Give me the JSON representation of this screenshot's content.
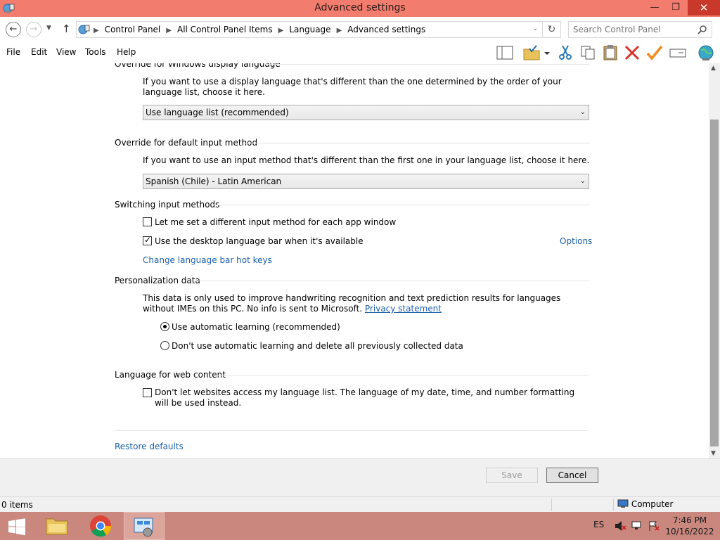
{
  "window": {
    "title": "Advanced settings",
    "minimize_glyph": "—",
    "maximize_glyph": "❐",
    "close_glyph": "✕"
  },
  "address": {
    "breadcrumbs": [
      "Control Panel",
      "All Control Panel Items",
      "Language",
      "Advanced settings"
    ],
    "search_placeholder": "Search Control Panel"
  },
  "menu": {
    "items": [
      "File",
      "Edit",
      "View",
      "Tools",
      "Help"
    ]
  },
  "toolbar": {
    "icons": [
      "layout-pane-icon",
      "folder-check-icon",
      "dropdown-icon",
      "cut-icon",
      "copy-icon",
      "paste-icon",
      "delete-icon",
      "checkmark-icon",
      "properties-icon",
      "globe-icon"
    ]
  },
  "sections": {
    "display_language": {
      "heading": "Override for Windows display language",
      "description": "If you want to use a display language that's different than the one determined by the order of your language list, choose it here.",
      "selected": "Use language list (recommended)"
    },
    "input_method": {
      "heading": "Override for default input method",
      "description": "If you want to use an input method that's different than the first one in your language list, choose it here.",
      "selected": "Spanish (Chile) - Latin American"
    },
    "switching": {
      "heading": "Switching input methods",
      "option1": "Let me set a different input method for each app window",
      "option1_checked": false,
      "option2": "Use the desktop language bar when it's available",
      "option2_checked": true,
      "options_link": "Options",
      "hotkeys_link": "Change language bar hot keys"
    },
    "personalization": {
      "heading": "Personalization data",
      "description": "This data is only used to improve handwriting recognition and text prediction results for languages without IMEs on this PC. No info is sent to Microsoft.",
      "privacy_link": "Privacy statement",
      "radio1": "Use automatic learning (recommended)",
      "radio2": "Don't use automatic learning and delete all previously collected data",
      "selected_radio": 1
    },
    "web_content": {
      "heading": "Language for web content",
      "option": "Don't let websites access my language list. The language of my date, time, and number formatting will be used instead.",
      "option_checked": false
    },
    "restore_defaults": "Restore defaults"
  },
  "buttons": {
    "save": "Save",
    "cancel": "Cancel"
  },
  "status": {
    "items": "0 items",
    "location": "Computer"
  },
  "taskbar": {
    "language": "ES",
    "time": "7:46 PM",
    "date": "10/16/2022"
  },
  "colors": {
    "titlebar": "#f27d6e",
    "taskbar": "#c9877e",
    "link": "#1a5fa8"
  }
}
